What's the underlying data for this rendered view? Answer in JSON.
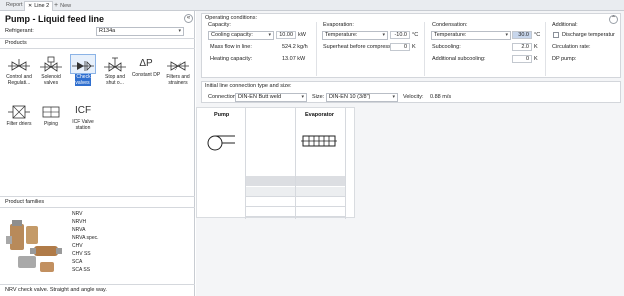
{
  "tabs": [
    {
      "label": "Report",
      "active": false
    },
    {
      "label": "Line 2",
      "active": true,
      "close": "✕"
    },
    {
      "label": "New",
      "active": false,
      "icon": "+"
    }
  ],
  "left": {
    "title": "Pump - Liquid feed line",
    "refrigerant_label": "Refrigerant:",
    "refrigerant_value": "R134a",
    "products_label": "Products",
    "collapse_glyph": "«",
    "products": [
      {
        "label": "Control and Regulati...",
        "icon": "valve-icon"
      },
      {
        "label": "Solenoid valves",
        "icon": "solenoid-valve-icon"
      },
      {
        "label": "Check valves",
        "icon": "check-valve-icon",
        "selected": true
      },
      {
        "label": "Stop and shut o...",
        "icon": "stop-valve-icon"
      },
      {
        "label": "Constant DP",
        "icon": "delta-p-icon",
        "glyph": "ΔP"
      },
      {
        "label": "Filters and strainers",
        "icon": "strainer-icon"
      },
      {
        "label": "Filter driers",
        "icon": "filter-drier-icon"
      },
      {
        "label": "Piping",
        "icon": "piping-icon"
      },
      {
        "label": "ICF Valve station",
        "icon": "icf-icon",
        "glyph": "ICF"
      }
    ],
    "families_label": "Product families",
    "families": [
      "NRV",
      "NRVH",
      "NRVA",
      "NRVA spec.",
      "CHV",
      "CHV SS",
      "SCA",
      "SCA SS"
    ],
    "status": "NRV check valve. Straight and angle way."
  },
  "operating": {
    "title": "Operating conditions:",
    "capacity": {
      "header": "Capacity:",
      "mode": "Cooling capacity:",
      "value": "10.00",
      "unit": "kW",
      "mass_flow_label": "Mass flow in line:",
      "mass_flow_value": "524.2 kg/h",
      "heating_label": "Heating capacity:",
      "heating_value": "13.07 kW"
    },
    "evaporation": {
      "header": "Evaporation:",
      "mode": "Temperature:",
      "value": "-10.0",
      "unit": "°C",
      "superheat_label": "Superheat before compressor:",
      "superheat_value": "0",
      "superheat_unit": "K"
    },
    "condensation": {
      "header": "Condensation:",
      "mode": "Temperature:",
      "value": "30.0",
      "unit": "°C",
      "subcool_label": "Subcooling:",
      "subcool_value": "2.0",
      "subcool_unit": "K",
      "add_subcool_label": "Additional subcooling:",
      "add_subcool_value": "0",
      "add_subcool_unit": "K"
    },
    "additional": {
      "header": "Additional:",
      "discharge_label": "Discharge temperatur",
      "circulation_label": "Circulation rate:",
      "dp_pump_label": "DP pump:"
    },
    "collapse_glyph": "⌃"
  },
  "connection": {
    "title": "Initial line connection type and size:",
    "connection_label": "Connection:",
    "connection_value": "DIN-EN Butt weld",
    "size_label": "Size:",
    "size_value": "DIN-EN 10 (3/8\")",
    "velocity_label": "Velocity:",
    "velocity_value": "0.88 m/s"
  },
  "diagram": {
    "col1": "Pump",
    "col2": "Evaporator"
  }
}
